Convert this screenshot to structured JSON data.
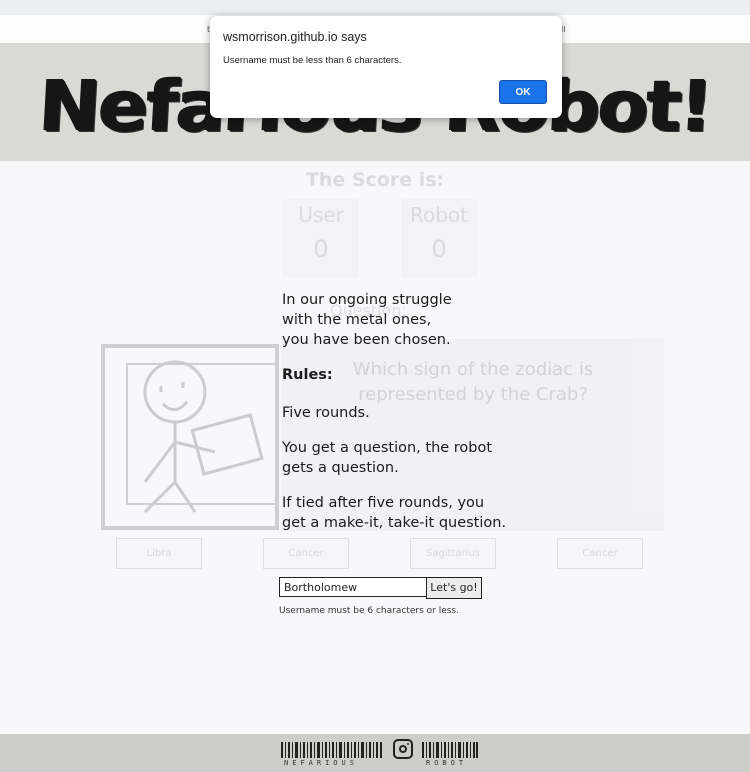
{
  "subbar": {
    "left_fragment": "t",
    "right_fragment": "ll"
  },
  "header": {
    "title": "Nefarious Robot!"
  },
  "scoreboard": {
    "title": "The Score is:",
    "user": {
      "label": "User",
      "score": "0"
    },
    "robot": {
      "label": "Robot",
      "score": "0"
    }
  },
  "question": {
    "label": "Question:",
    "text": "Which sign of the zodiac is represented by the Crab?",
    "answers": [
      "Libra",
      "Cancer",
      "Sagittarius",
      "Cancer"
    ]
  },
  "modal": {
    "intro": [
      "In our ongoing struggle",
      "with the metal ones,",
      "you have been chosen."
    ],
    "rules_heading": "Rules:",
    "rule1": "Five rounds.",
    "rule2": "You get a question, the robot gets a question.",
    "rule3": "If tied after five rounds, you get a make-it, take-it question.",
    "username_value": "Bortholomew",
    "go_label": "Let's go!",
    "note": "Username must be 6 characters or less."
  },
  "footer": {
    "left_word": "NEFARIOUS",
    "right_word": "ROBOT",
    "social_icon": "instagram-icon"
  },
  "dialog": {
    "title": "wsmorrison.github.io says",
    "message": "Username must be less than 6 characters.",
    "ok_label": "OK",
    "accent": "#1a73e8"
  }
}
